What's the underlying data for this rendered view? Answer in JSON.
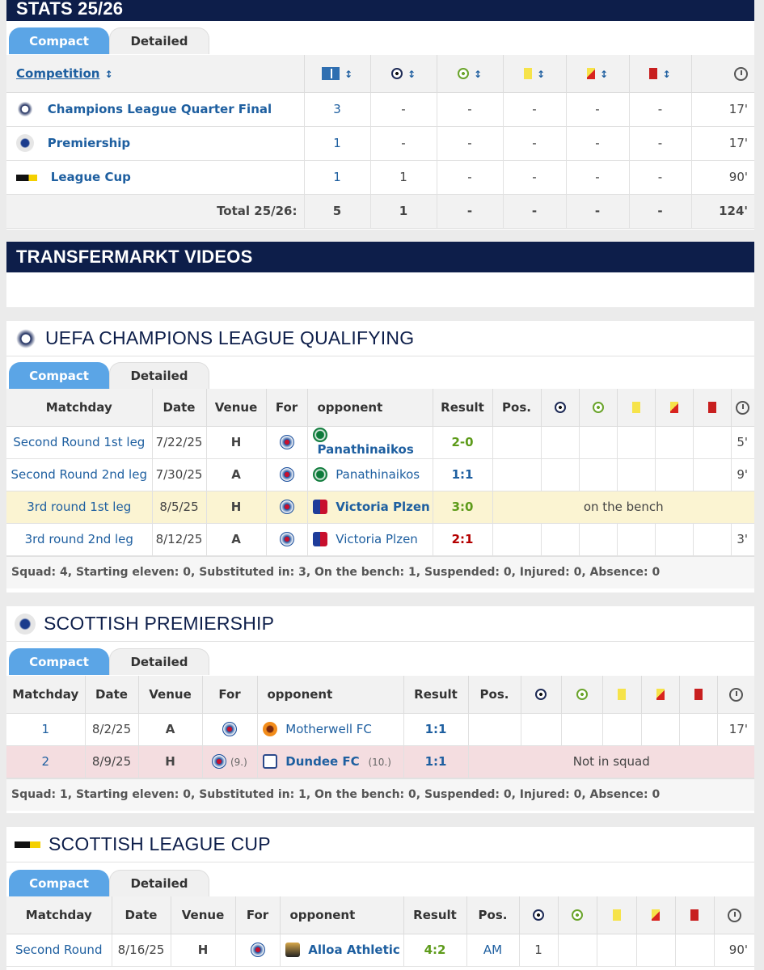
{
  "stats": {
    "title": "STATS 25/26",
    "tab_compact": "Compact",
    "tab_detailed": "Detailed",
    "col_competition": "Competition",
    "rows": [
      {
        "comp": "Champions League Quarter Final",
        "apps": "3",
        "goals": "-",
        "assists": "-",
        "yellow": "-",
        "yellowred": "-",
        "red": "-",
        "minutes": "17'"
      },
      {
        "comp": "Premiership",
        "apps": "1",
        "goals": "-",
        "assists": "-",
        "yellow": "-",
        "yellowred": "-",
        "red": "-",
        "minutes": "17'"
      },
      {
        "comp": "League Cup",
        "apps": "1",
        "goals": "1",
        "assists": "-",
        "yellow": "-",
        "yellowred": "-",
        "red": "-",
        "minutes": "90'"
      }
    ],
    "total": {
      "label": "Total 25/26:",
      "apps": "5",
      "goals": "1",
      "assists": "-",
      "yellow": "-",
      "yellowred": "-",
      "red": "-",
      "minutes": "124'"
    }
  },
  "videos": {
    "title": "TRANSFERMARKT VIDEOS"
  },
  "ucl": {
    "title": "UEFA CHAMPIONS LEAGUE QUALIFYING",
    "tab_compact": "Compact",
    "tab_detailed": "Detailed",
    "headers": {
      "matchday": "Matchday",
      "date": "Date",
      "venue": "Venue",
      "for": "For",
      "opponent": "opponent",
      "result": "Result",
      "pos": "Pos."
    },
    "rows": [
      {
        "matchday": "Second Round 1st leg",
        "date": "7/22/25",
        "venue": "H",
        "opponent": "Panathinaikos",
        "result": "2-0",
        "minutes": "5'"
      },
      {
        "matchday": "Second Round 2nd leg",
        "date": "7/30/25",
        "venue": "A",
        "opponent": "Panathinaikos",
        "result": "1:1",
        "minutes": "9'"
      },
      {
        "matchday": "3rd round 1st leg",
        "date": "8/5/25",
        "venue": "H",
        "opponent": "Victoria Plzen",
        "result": "3:0",
        "note": "on the bench"
      },
      {
        "matchday": "3rd round 2nd leg",
        "date": "8/12/25",
        "venue": "A",
        "opponent": "Victoria Plzen",
        "result": "2:1",
        "minutes": "3'"
      }
    ],
    "footer": "Squad: 4, Starting eleven: 0, Substituted in: 3, On the bench: 1, Suspended: 0, Injured: 0, Absence: 0"
  },
  "prem": {
    "title": "SCOTTISH PREMIERSHIP",
    "tab_compact": "Compact",
    "tab_detailed": "Detailed",
    "headers": {
      "matchday": "Matchday",
      "date": "Date",
      "venue": "Venue",
      "for": "For",
      "opponent": "opponent",
      "result": "Result",
      "pos": "Pos."
    },
    "rows": [
      {
        "matchday": "1",
        "date": "8/2/25",
        "venue": "A",
        "opponent": "Motherwell FC",
        "result": "1:1",
        "minutes": "17'"
      },
      {
        "matchday": "2",
        "date": "8/9/25",
        "venue": "H",
        "for_rank": "(9.)",
        "opponent": "Dundee FC",
        "opp_rank": "(10.)",
        "result": "1:1",
        "note": "Not in squad"
      }
    ],
    "footer": "Squad: 1, Starting eleven: 0, Substituted in: 1, On the bench: 0, Suspended: 0, Injured: 0, Absence: 0"
  },
  "cup": {
    "title": "SCOTTISH LEAGUE CUP",
    "tab_compact": "Compact",
    "tab_detailed": "Detailed",
    "headers": {
      "matchday": "Matchday",
      "date": "Date",
      "venue": "Venue",
      "for": "For",
      "opponent": "opponent",
      "result": "Result",
      "pos": "Pos."
    },
    "rows": [
      {
        "matchday": "Second Round",
        "date": "8/16/25",
        "venue": "H",
        "opponent": "Alloa Athletic",
        "result": "4:2",
        "pos": "AM",
        "goals": "1",
        "minutes": "90'"
      }
    ]
  }
}
